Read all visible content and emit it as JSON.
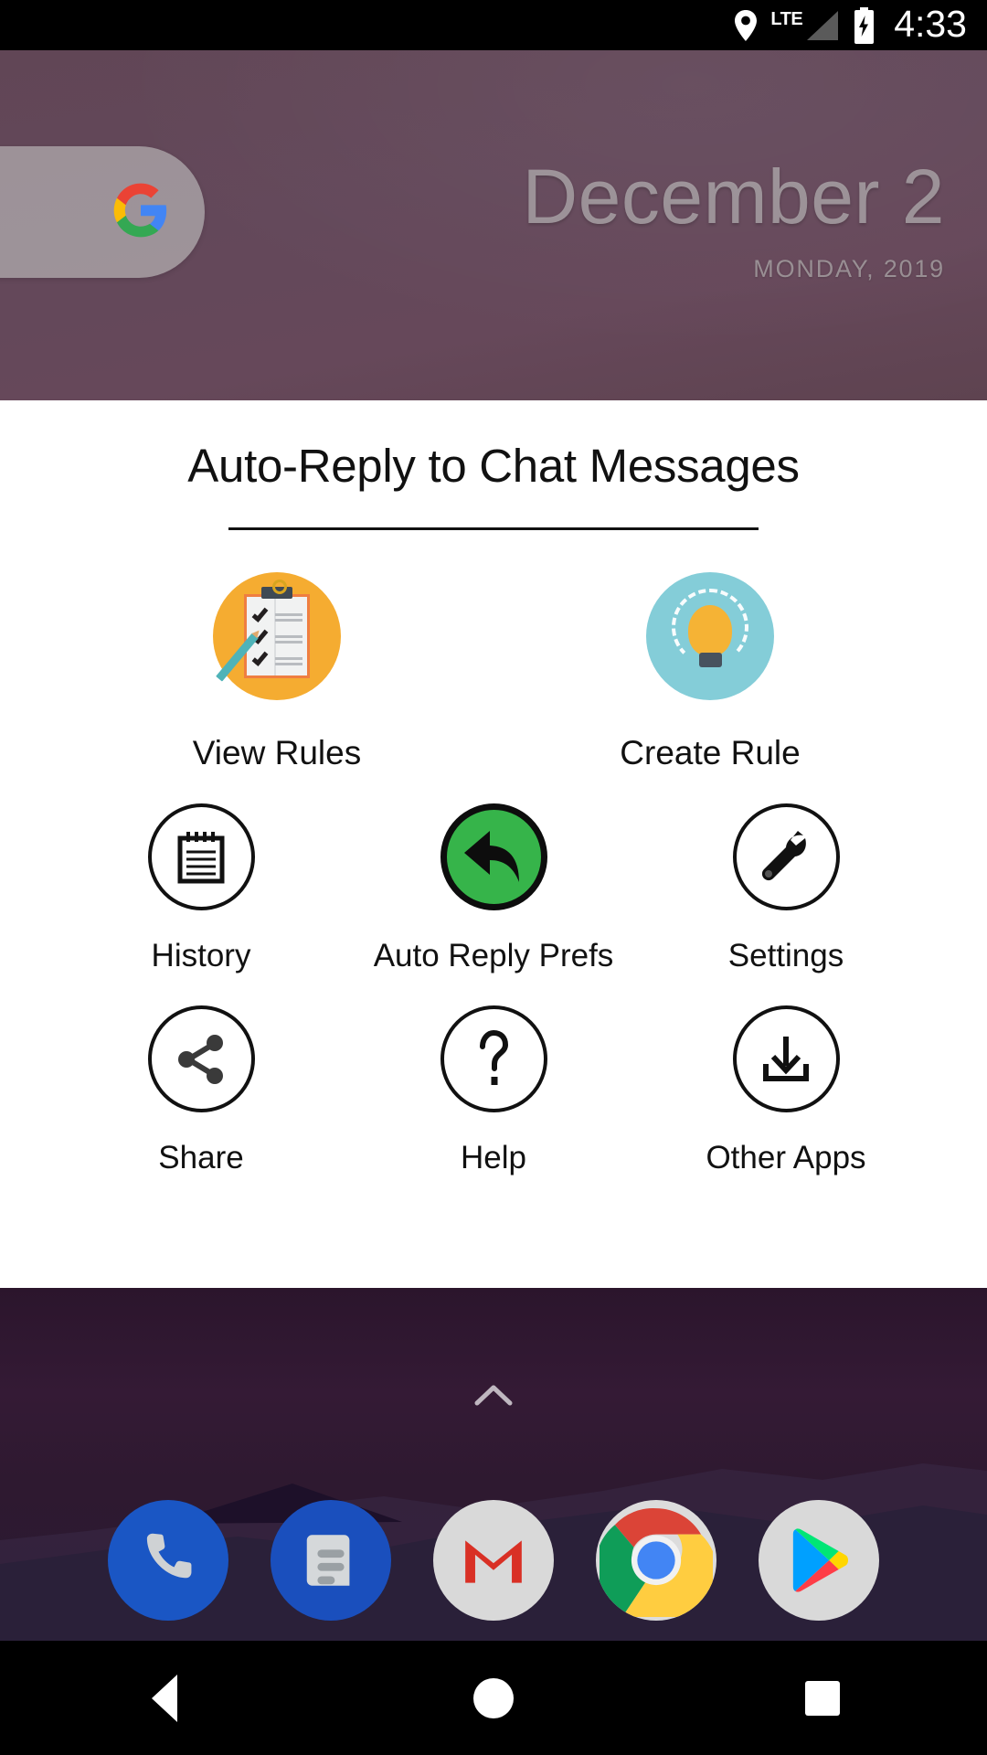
{
  "status_bar": {
    "location_icon": "location-pin-icon",
    "network_label": "LTE",
    "signal_icon": "signal-bars-icon",
    "battery_icon": "battery-charging-icon",
    "time": "4:33"
  },
  "home_screen": {
    "search_widget": {
      "icon": "google-g-icon",
      "name": "google-search-pill"
    },
    "date_widget": {
      "date": "December 2",
      "day_year": "MONDAY, 2019"
    },
    "app_drawer_handle": "chevron-up-icon",
    "dock": [
      {
        "name": "dock-phone",
        "label": "Phone",
        "icon": "phone-icon"
      },
      {
        "name": "dock-messages",
        "label": "Messages",
        "icon": "messages-icon"
      },
      {
        "name": "dock-gmail",
        "label": "Gmail",
        "icon": "gmail-icon"
      },
      {
        "name": "dock-chrome",
        "label": "Chrome",
        "icon": "chrome-icon"
      },
      {
        "name": "dock-play",
        "label": "Play Store",
        "icon": "play-store-icon"
      }
    ]
  },
  "dialog": {
    "title": "Auto-Reply to Chat Messages",
    "featured": [
      {
        "label": "View Rules",
        "icon": "clipboard-checklist-icon",
        "bg_color": "#f5ac31"
      },
      {
        "label": "Create Rule",
        "icon": "lightbulb-icon",
        "bg_color": "#84cdd8"
      }
    ],
    "rows": [
      [
        {
          "label": "History",
          "icon": "notepad-icon"
        },
        {
          "label": "Auto Reply Prefs",
          "icon": "reply-arrow-icon",
          "bg_color": "#36b44a"
        },
        {
          "label": "Settings",
          "icon": "wrench-icon"
        }
      ],
      [
        {
          "label": "Share",
          "icon": "share-nodes-icon"
        },
        {
          "label": "Help",
          "icon": "question-mark-icon"
        },
        {
          "label": "Other Apps",
          "icon": "download-tray-icon"
        }
      ]
    ]
  },
  "nav_bar": {
    "back": "back-triangle-icon",
    "home": "home-circle-icon",
    "recents": "recents-square-icon"
  },
  "colors": {
    "wallpaper_top": "#63485a",
    "wallpaper_bottom": "#2e1930",
    "dialog_bg": "#ffffff",
    "text": "#111111",
    "accent_green": "#36b44a",
    "accent_orange": "#f5ac31",
    "accent_teal": "#84cdd8"
  }
}
